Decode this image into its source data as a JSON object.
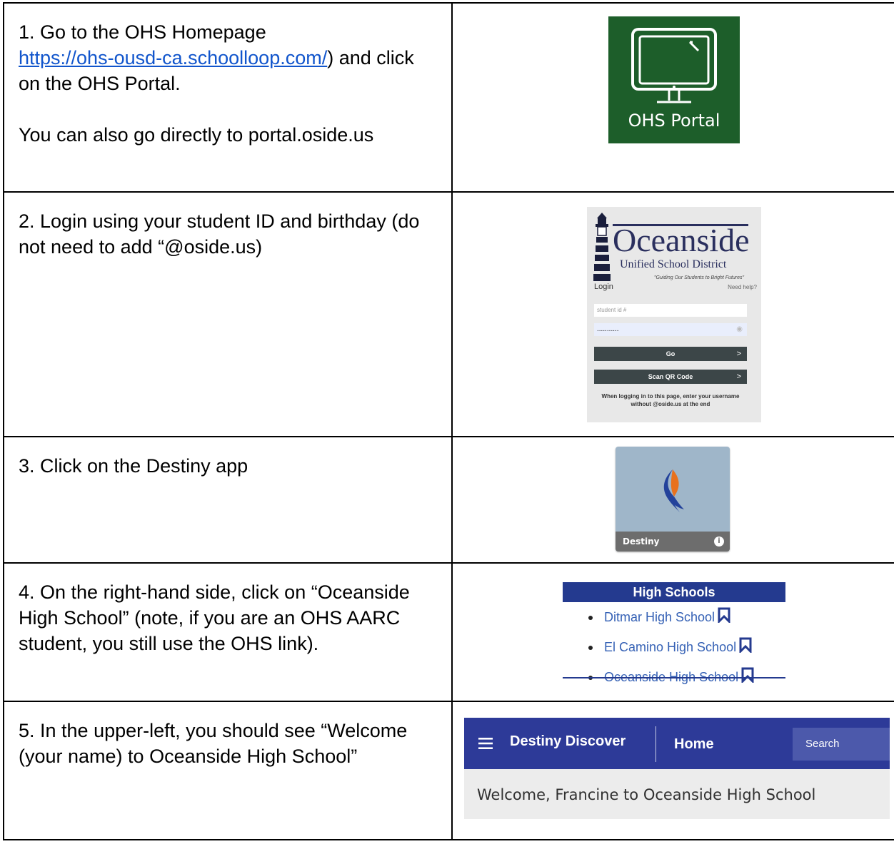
{
  "steps": [
    {
      "number": "1.",
      "text_before_link": "Go to the OHS Homepage",
      "link": "https://ohs-ousd-ca.schoolloop.com/",
      "text_after_link": ") and click on the OHS Portal.",
      "extra": "You can also go directly to portal.oside.us"
    },
    {
      "text": "2. Login using your student ID and birthday (do not need to add “@oside.us)"
    },
    {
      "text": "3. Click on the Destiny app"
    },
    {
      "text": "4. On the right-hand side, click on “Oceanside High School” (note, if you are an OHS AARC student, you still use the OHS link)."
    },
    {
      "text": "5. In the upper-left, you should see “Welcome (your name) to Oceanside High School”"
    }
  ],
  "portal_tile": {
    "label": "OHS Portal",
    "bg_color": "#1d5e2a",
    "icon": "monitor-icon"
  },
  "login_screen": {
    "brand": "Oceanside",
    "district": "Unified School District",
    "tagline": "\"Guiding Our Students to Bright Futures\"",
    "login_label": "Login",
    "help_link": "Need help?",
    "username_placeholder": "student id #",
    "password_value": "...........",
    "go_button": "Go",
    "qr_button": "Scan QR Code",
    "note": "When logging in to this page, enter your username without @oside.us at the end",
    "icon": "lighthouse-icon"
  },
  "destiny_tile": {
    "label": "Destiny",
    "bg_color": "#9fb6c9"
  },
  "high_schools": {
    "heading": "High Schools",
    "items": [
      "Ditmar High School",
      "El Camino High School",
      "Oceanside High School"
    ],
    "accent": "#243a8f"
  },
  "destiny_discover": {
    "brand": "Destiny Discover",
    "nav_home": "Home",
    "search_label": "Search",
    "welcome": "Welcome, Francine to Oceanside High School",
    "bar_color": "#2d3a98"
  }
}
